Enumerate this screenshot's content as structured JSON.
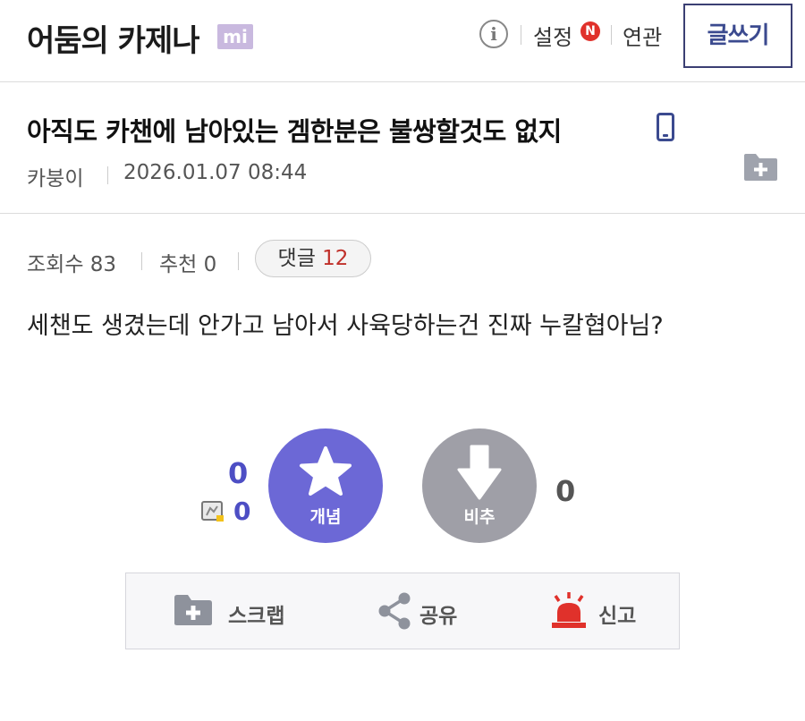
{
  "header": {
    "gallery_title": "어둠의 카제나",
    "badge": "mi",
    "info_glyph": "i",
    "settings": "설정",
    "settings_badge": "N",
    "related": "연관",
    "write_button": "글쓰기"
  },
  "post": {
    "title": "아직도 카챈에 남아있는 겜한분은 불쌍할것도 없지",
    "author": "카붕이",
    "date": "2026.01.07 08:44",
    "views_text": "조회수 83",
    "recommend_text": "추천 0",
    "comment_label": "댓글",
    "comment_count": "12",
    "body": "세챈도 생겼는데 안가고 남아서 사육당하는건 진짜 누칼협아님?"
  },
  "votes": {
    "up_count": "0",
    "fixed_count": "0",
    "upvote_label": "개념",
    "downvote_label": "비추",
    "down_count": "0"
  },
  "actions": {
    "scrap": "스크랩",
    "share": "공유",
    "report": "신고"
  },
  "colors": {
    "accent": "#6c68d6",
    "title_border": "#3b3f73",
    "report_red": "#e0312b",
    "downvote_gray": "#9f9fa7"
  },
  "icons": [
    "info-icon",
    "new-badge-icon",
    "mobile-icon",
    "folder-add-icon",
    "star-icon",
    "arrow-down-icon",
    "fix-icon",
    "share-icon",
    "siren-icon"
  ]
}
